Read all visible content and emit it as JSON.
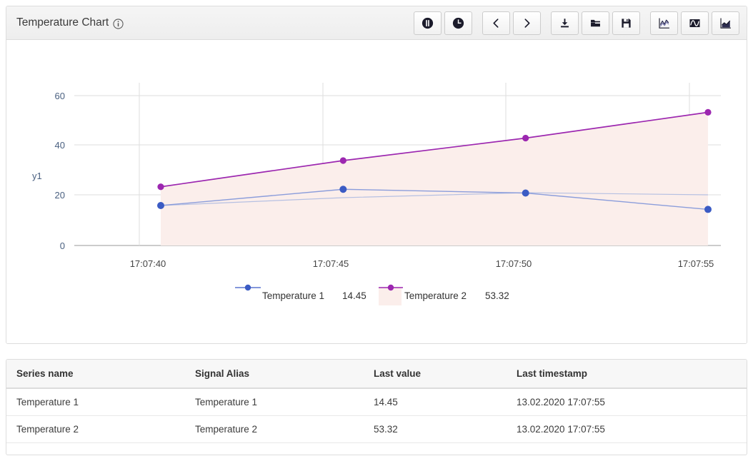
{
  "panel": {
    "title": "Temperature Chart",
    "info_icon": "info-circle-icon"
  },
  "toolbar": {
    "groups": [
      {
        "buttons": [
          {
            "name": "pause-button",
            "icon": "pause-circle-icon",
            "label": "Pause"
          },
          {
            "name": "realtime-button",
            "icon": "clock-icon",
            "label": "Realtime"
          }
        ]
      },
      {
        "buttons": [
          {
            "name": "previous-button",
            "icon": "chevron-left-icon",
            "label": "Previous"
          },
          {
            "name": "next-button",
            "icon": "chevron-right-icon",
            "label": "Next"
          }
        ]
      },
      {
        "buttons": [
          {
            "name": "download-button",
            "icon": "download-icon",
            "label": "Download"
          },
          {
            "name": "open-button",
            "icon": "folder-open-icon",
            "label": "Open"
          },
          {
            "name": "save-button",
            "icon": "floppy-disk-icon",
            "label": "Save"
          }
        ]
      },
      {
        "buttons": [
          {
            "name": "line-chart-button",
            "icon": "line-chart-icon",
            "label": "Line chart"
          },
          {
            "name": "wave-chart-button",
            "icon": "sine-wave-icon",
            "label": "Wave chart"
          },
          {
            "name": "area-chart-button",
            "icon": "area-chart-icon",
            "label": "Area chart"
          }
        ]
      }
    ]
  },
  "colors": {
    "series_1": "#3b5bc4",
    "series_1_line": "#8b9ddb",
    "series_2": "#9c27b0",
    "series_2_line": "#9c27b0",
    "series_2_fill": "#fbeeeb",
    "grid": "#dddddd",
    "axis_text": "#4a6080"
  },
  "chart_data": {
    "type": "line",
    "title": "Temperature Chart",
    "xlabel": "",
    "ylabel": "y1",
    "x": [
      "17:07:40",
      "17:07:45",
      "17:07:50",
      "17:07:55"
    ],
    "xtick_labels": [
      "17:07:40",
      "17:07:45",
      "17:07:50",
      "17:07:55"
    ],
    "ytick_labels": [
      "0",
      "20",
      "40",
      "60"
    ],
    "ylim": [
      0,
      60
    ],
    "yticks": [
      0,
      20,
      40,
      60
    ],
    "grid": true,
    "legend_position": "bottom",
    "series": [
      {
        "name": "Temperature 1",
        "color": "#3b5bc4",
        "last_value": "14.45",
        "values": [
          16.0,
          22.5,
          21.0,
          14.45
        ],
        "filled": false
      },
      {
        "name": "Temperature 2",
        "color": "#9c27b0",
        "last_value": "53.32",
        "values": [
          23.5,
          34.0,
          43.0,
          53.32
        ],
        "filled": true
      }
    ]
  },
  "legend": [
    {
      "name": "Temperature 1",
      "value": "14.45",
      "color": "#3b5bc4",
      "swatch": "line-marker",
      "fill": false
    },
    {
      "name": "Temperature 2",
      "value": "53.32",
      "color": "#9c27b0",
      "swatch": "line-marker",
      "fill": true
    }
  ],
  "table": {
    "columns": [
      "Series name",
      "Signal Alias",
      "Last value",
      "Last timestamp"
    ],
    "rows": [
      {
        "series_name": "Temperature 1",
        "signal_alias": "Temperature 1",
        "last_value": "14.45",
        "last_timestamp": "13.02.2020 17:07:55"
      },
      {
        "series_name": "Temperature 2",
        "signal_alias": "Temperature 2",
        "last_value": "53.32",
        "last_timestamp": "13.02.2020 17:07:55"
      }
    ]
  }
}
